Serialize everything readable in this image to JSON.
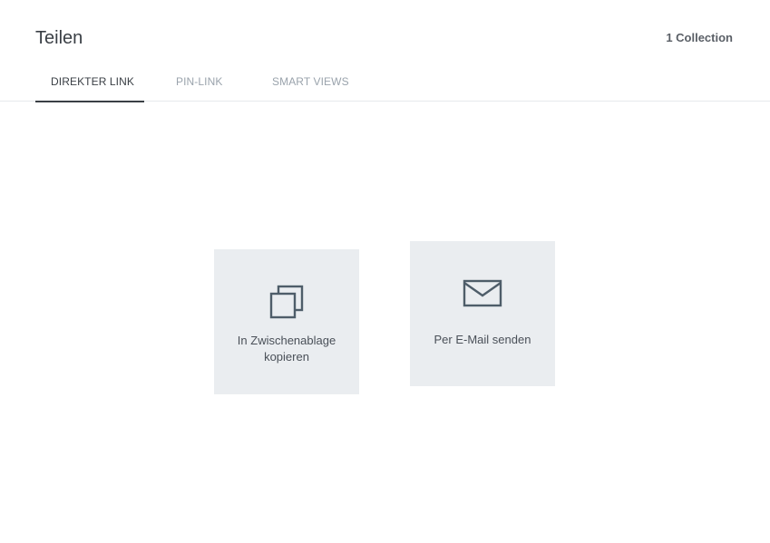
{
  "header": {
    "title": "Teilen",
    "count": "1 Collection"
  },
  "tabs": [
    {
      "label": "DIREKTER LINK",
      "active": true
    },
    {
      "label": "PIN-LINK",
      "active": false
    },
    {
      "label": "SMART VIEWS",
      "active": false
    }
  ],
  "actions": {
    "copy": {
      "label_line1": "In Zwischenablage",
      "label_line2": "kopieren",
      "icon": "copy-icon"
    },
    "email": {
      "label": "Per E-Mail senden",
      "icon": "envelope-icon"
    }
  },
  "colors": {
    "tile_bg": "#eaedf0",
    "icon_stroke": "#4e5d69",
    "active_tab": "#3a3f45",
    "inactive_tab": "#9aa3ac"
  }
}
